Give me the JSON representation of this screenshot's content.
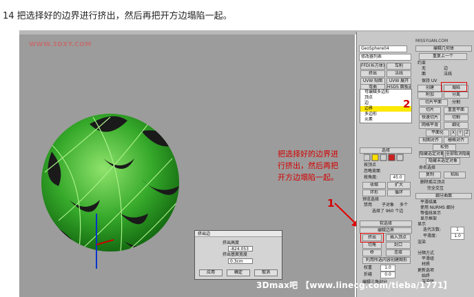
{
  "caption": "14 把选择好的边界进行挤出，然后再把开方边塌陷一起。",
  "watermark_top": "WWW.3DXY.COM",
  "watermark_bottom": "3Dmax吧 【www.linecg.com/tieba/1771】",
  "panel": {
    "object_name": "GeoSphere04",
    "modifier_list": "修改器列表",
    "btns_row1": [
      "FFD(长方体)",
      "车削"
    ],
    "btns_row2": [
      "挤出",
      "法线"
    ],
    "btns_row3": [
      "UVW 贴图",
      "UVW 展开"
    ],
    "btns_row4": [
      "弯曲",
      "HSDS 面板选项"
    ],
    "stack_title": "可编辑多边形",
    "stack_items": [
      "顶点",
      "边",
      "边界",
      "多边形",
      "元素"
    ],
    "stack_selected": "边界",
    "right_top_link": "MISSYUAN.COM",
    "right_title": "编辑几何体",
    "repeat_last": "重复上一个",
    "constraint_label": "约束",
    "radio_none": "无",
    "radio_edge": "边",
    "radio_face": "面",
    "radio_normal": "法线",
    "keep_uv": "保持 UV",
    "create": "创建",
    "collapse": "塌陷",
    "attach": "附加",
    "detach": "分离",
    "slice_plane": "切片平面",
    "split": "分割",
    "slice": "切片",
    "reset_plane": "重置平面",
    "quickslice": "快速切片",
    "cut": "切割",
    "meshsmooth": "网格平滑",
    "tessellate": "细化",
    "planarize": "平面化",
    "xyz": [
      "X",
      "Y",
      "Z"
    ],
    "view_align": "视图对齐",
    "grid_align": "栅格对齐",
    "relax": "松弛",
    "hide_sel": "隐藏选定对象",
    "unhide_all": "全部取消隐藏",
    "hide_unsel": "隐藏未选定对象",
    "named_sel": "命名选择",
    "copy": "复制",
    "paste": "粘贴",
    "delete_iso": "删除孤立顶点",
    "full_interact": "完全交互",
    "subdiv_title": "细分曲面",
    "smooth_result": "平滑结果",
    "use_nurms": "使用 NURMS 细分",
    "iso_display": "等值线显示",
    "show_cage": "显示框架",
    "display_label": "显示",
    "iterations": "迭代次数:",
    "iterations_val": "1",
    "smoothness": "平滑度:",
    "smoothness_val": "1.0",
    "render_label": "渲染",
    "sep_by": "分隔方式",
    "smoothing_groups": "平滑组",
    "materials": "材质",
    "update_opts": "更新选项",
    "always": "始终",
    "when_render": "渲染时",
    "selection_title": "选择",
    "by_vertex": "按顶点",
    "ignore_back": "忽略背面",
    "by_angle": "按角度:",
    "angle_val": "45.0",
    "shrink": "收缩",
    "grow": "扩大",
    "ring": "环形",
    "loop": "循环",
    "selected_text": "选择了 960 个边",
    "preview_sel": "预览选择",
    "disabled": "禁用",
    "subobj": "子对象",
    "multi": "多个",
    "soft_sel": "软选择",
    "edit_border": "编辑边界",
    "extrude": "挤出",
    "insert_vertex": "插入顶点",
    "chamfer": "切角",
    "cap": "封口",
    "bridge": "桥",
    "connect": "连接",
    "create_shape": "利用所选内容创建图形",
    "weight": "权重",
    "weight_val": "1.0",
    "crease": "折缝",
    "crease_val": "0.0",
    "edit_tri": "编辑三角剖分",
    "num_2": "2"
  },
  "note": "把选择好的边界进行挤出，然后再把开方边塌陷一起。",
  "num_1": "1",
  "dialog": {
    "title": "挤出边",
    "height_label": "挤出高度",
    "height_val": "-824.053",
    "base_label": "挤出基面宽度",
    "base_val": "0.3cm",
    "apply": "应用",
    "ok": "确定",
    "cancel": "取消"
  }
}
